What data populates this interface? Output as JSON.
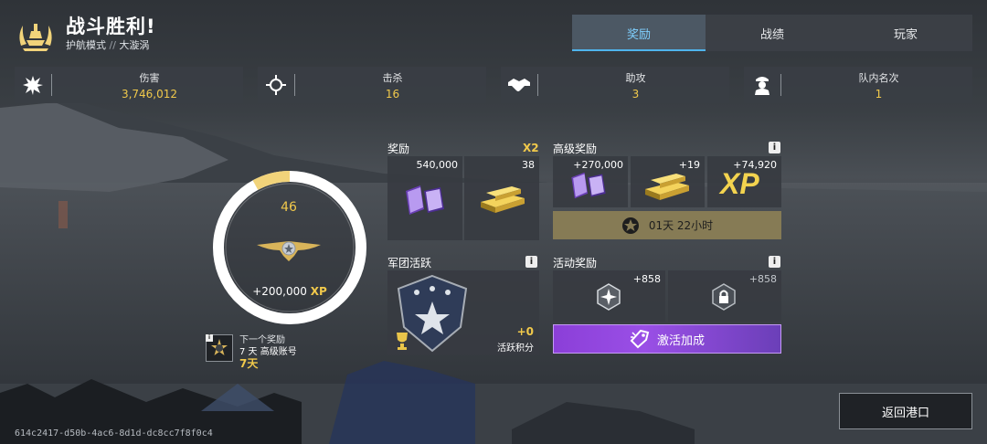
{
  "header": {
    "title": "战斗胜利!",
    "mode": "护航模式",
    "separator": "//",
    "map": "大漩涡"
  },
  "tabs": [
    {
      "label": "奖励",
      "active": true
    },
    {
      "label": "战绩",
      "active": false
    },
    {
      "label": "玩家",
      "active": false
    }
  ],
  "stats": [
    {
      "label": "伤害",
      "value": "3,746,012",
      "icon": "explosion-icon"
    },
    {
      "label": "击杀",
      "value": "16",
      "icon": "crosshair-icon"
    },
    {
      "label": "助攻",
      "value": "3",
      "icon": "handshake-icon"
    },
    {
      "label": "队内名次",
      "value": "1",
      "icon": "soldier-rank-icon"
    }
  ],
  "progress": {
    "level": "46",
    "xp_gain": "+200,000",
    "xp_unit": "XP",
    "progress_fraction": 0.08
  },
  "next_reward": {
    "label": "下一个奖励",
    "name": "7 天 高级账号",
    "days": "7天"
  },
  "rewards": {
    "title": "奖励",
    "multiplier": "X2",
    "items": [
      {
        "amount": "540,000",
        "icon": "credits-books-icon"
      },
      {
        "amount": "38",
        "icon": "gold-bars-icon"
      }
    ]
  },
  "premium_rewards": {
    "title": "高级奖励",
    "info": "i",
    "items": [
      {
        "amount": "+270,000",
        "icon": "credits-books-icon"
      },
      {
        "amount": "+19",
        "icon": "gold-bars-icon"
      },
      {
        "amount": "+74,920",
        "icon": "xp-icon",
        "symbol": "XP"
      }
    ],
    "timer": "01天 22小时"
  },
  "legion": {
    "title": "军团活跃",
    "info": "i",
    "points": "+0",
    "points_label": "活跃积分"
  },
  "event_rewards": {
    "title": "活动奖励",
    "info": "i",
    "items": [
      {
        "amount": "+858",
        "icon": "compass-medal-icon"
      },
      {
        "amount": "+858",
        "icon": "lock-medal-icon"
      }
    ],
    "activate_label": "激活加成"
  },
  "footer": {
    "back_label": "返回港口",
    "uid": "614c2417-d50b-4ac6-8d1d-dc8cc7f8f0c4"
  },
  "colors": {
    "gold": "#f1c94b",
    "accent_blue": "#4fb4ec",
    "boost_purple": "#8b3fd8",
    "timer_bg": "#867b55"
  }
}
